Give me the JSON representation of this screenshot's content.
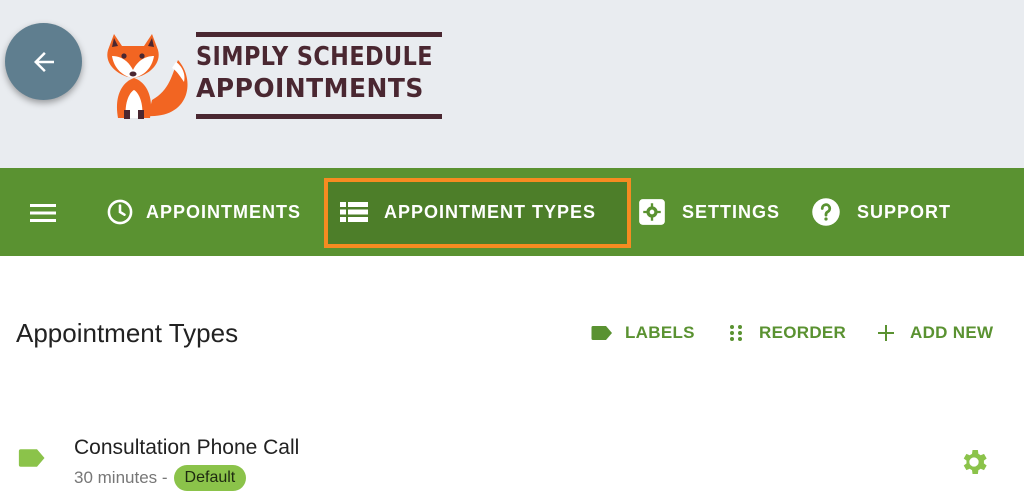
{
  "brand": {
    "line1": "SIMPLY SCHEDULE",
    "line2": "APPOINTMENTS",
    "mascot": "fox-logo"
  },
  "back_button": {
    "icon": "arrow-left-icon"
  },
  "nav": {
    "menu_icon": "hamburger-icon",
    "items": [
      {
        "label": "APPOINTMENTS",
        "icon": "clock-icon"
      },
      {
        "label": "APPOINTMENT TYPES",
        "icon": "list-icon",
        "active": true
      },
      {
        "label": "SETTINGS",
        "icon": "gear-icon"
      },
      {
        "label": "SUPPORT",
        "icon": "help-circle-icon"
      }
    ]
  },
  "page": {
    "title": "Appointment Types",
    "actions": [
      {
        "label": "LABELS",
        "icon": "label-tag-icon"
      },
      {
        "label": "REORDER",
        "icon": "drag-dots-icon"
      },
      {
        "label": "ADD NEW",
        "icon": "plus-icon"
      }
    ]
  },
  "appointment_types": [
    {
      "name": "Consultation Phone Call",
      "duration": "30 minutes -",
      "badge": "Default",
      "label_color": "#8bc34a",
      "settings_icon": "gear-icon"
    }
  ],
  "colors": {
    "nav_background": "#5a9231",
    "highlight_border": "#f68b21",
    "accent_green": "#5a9231",
    "brand_text": "#4a2731",
    "fox_orange": "#f26522"
  }
}
